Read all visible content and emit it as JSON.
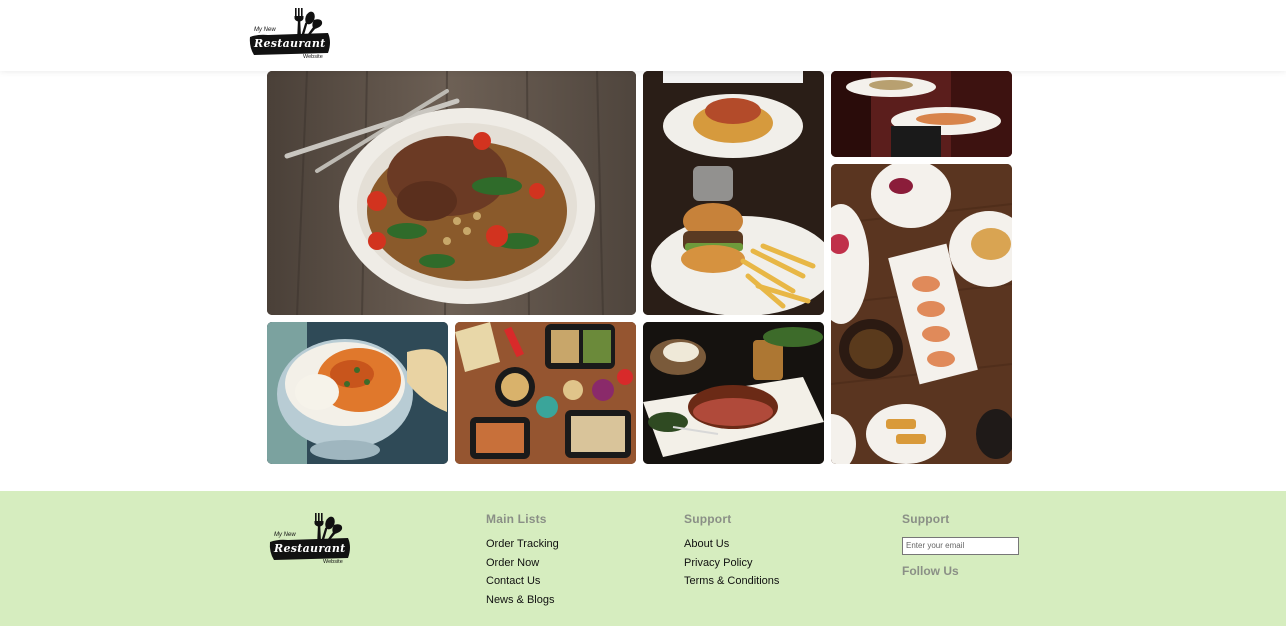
{
  "header": {
    "logo": {
      "top_text": "My New",
      "main_text": "Restaurant",
      "bottom_text": "Website"
    }
  },
  "gallery": {
    "items": [
      {
        "subject": "steak-with-vegetables-plate"
      },
      {
        "subject": "burger-and-fries"
      },
      {
        "subject": "waiter-serving-dishes"
      },
      {
        "subject": "seafood-table-spread"
      },
      {
        "subject": "curry-rice-bowl"
      },
      {
        "subject": "meal-prep-containers"
      },
      {
        "subject": "steak-with-baked-potato"
      }
    ]
  },
  "footer": {
    "logo": {
      "top_text": "My New",
      "main_text": "Restaurant",
      "bottom_text": "Website"
    },
    "main_lists": {
      "heading": "Main Lists",
      "links": [
        "Order Tracking",
        "Order Now",
        "Contact Us",
        "News & Blogs"
      ]
    },
    "support": {
      "heading": "Support",
      "links": [
        "About Us",
        "Privacy Policy",
        "Terms & Conditions"
      ]
    },
    "newsletter": {
      "heading": "Support",
      "email_placeholder": "Enter your email",
      "email_value": "",
      "follow_heading": "Follow Us"
    }
  },
  "colors": {
    "footer_bg": "#d6edbf",
    "heading_gray": "#8a8f86",
    "logo_black": "#111111"
  }
}
